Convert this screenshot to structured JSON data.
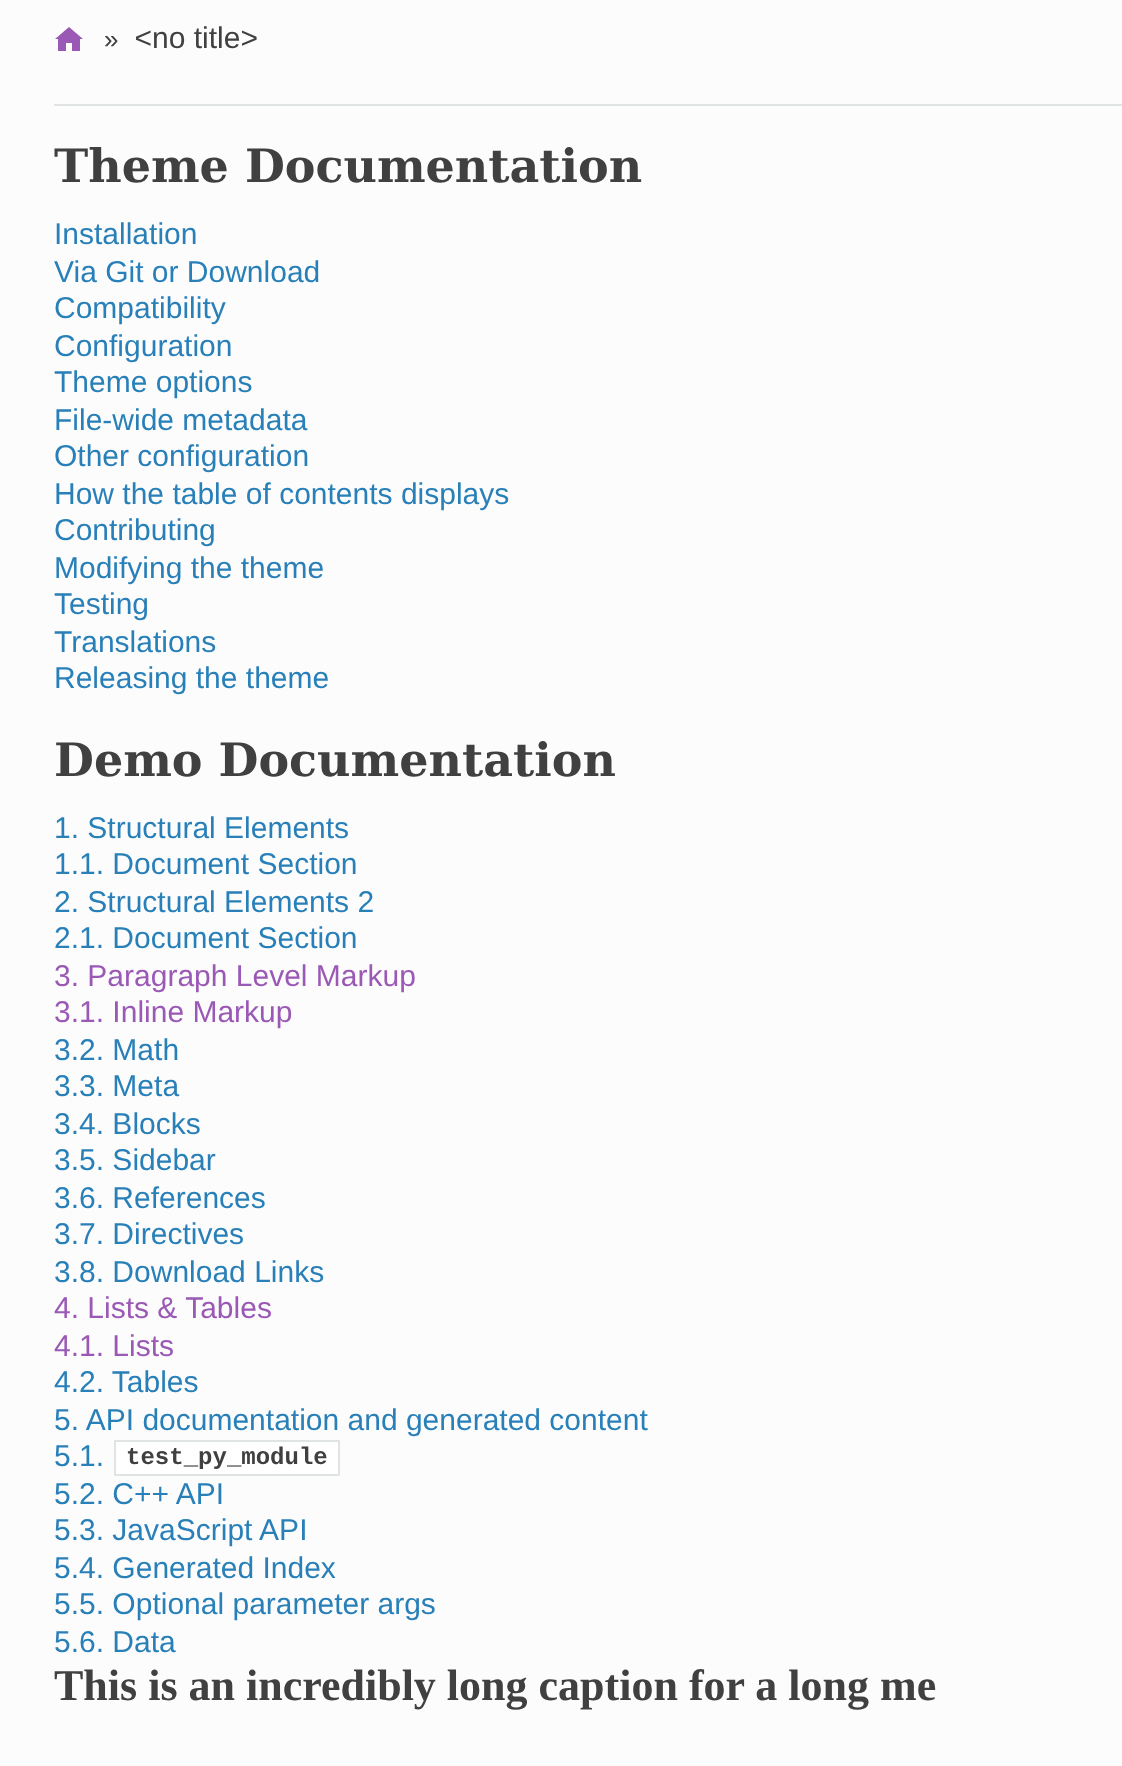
{
  "breadcrumb": {
    "separator": "»",
    "current": "<no title>"
  },
  "sections": [
    {
      "title": "Theme Documentation",
      "links": [
        {
          "label": "Installation",
          "visited": false
        },
        {
          "label": "Via Git or Download",
          "visited": false
        },
        {
          "label": "Compatibility",
          "visited": false
        },
        {
          "label": "Configuration",
          "visited": false
        },
        {
          "label": "Theme options",
          "visited": false
        },
        {
          "label": "File-wide metadata",
          "visited": false
        },
        {
          "label": "Other configuration",
          "visited": false
        },
        {
          "label": "How the table of contents displays",
          "visited": false
        },
        {
          "label": "Contributing",
          "visited": false
        },
        {
          "label": "Modifying the theme",
          "visited": false
        },
        {
          "label": "Testing",
          "visited": false
        },
        {
          "label": "Translations",
          "visited": false
        },
        {
          "label": "Releasing the theme",
          "visited": false
        }
      ]
    },
    {
      "title": "Demo Documentation",
      "links": [
        {
          "label": "1. Structural Elements",
          "visited": false
        },
        {
          "label": "1.1. Document Section",
          "visited": false
        },
        {
          "label": "2. Structural Elements 2",
          "visited": false
        },
        {
          "label": "2.1. Document Section",
          "visited": false
        },
        {
          "label": "3. Paragraph Level Markup",
          "visited": true
        },
        {
          "label": "3.1. Inline Markup",
          "visited": true
        },
        {
          "label": "3.2. Math",
          "visited": false
        },
        {
          "label": "3.3. Meta",
          "visited": false
        },
        {
          "label": "3.4. Blocks",
          "visited": false
        },
        {
          "label": "3.5. Sidebar",
          "visited": false
        },
        {
          "label": "3.6. References",
          "visited": false
        },
        {
          "label": "3.7. Directives",
          "visited": false
        },
        {
          "label": "3.8. Download Links",
          "visited": false
        },
        {
          "label": "4. Lists & Tables",
          "visited": true
        },
        {
          "label": "4.1. Lists",
          "visited": true
        },
        {
          "label": "4.2. Tables",
          "visited": false
        },
        {
          "label": "5. API documentation and generated content",
          "visited": false
        },
        {
          "label": "5.1.",
          "code": "test_py_module",
          "visited": false
        },
        {
          "label": "5.2. C++ API",
          "visited": false
        },
        {
          "label": "5.3. JavaScript API",
          "visited": false
        },
        {
          "label": "5.4. Generated Index",
          "visited": false
        },
        {
          "label": "5.5. Optional parameter args",
          "visited": false
        },
        {
          "label": "5.6. Data",
          "visited": false
        }
      ]
    },
    {
      "title": "This is an incredibly long caption for a long me"
    }
  ]
}
